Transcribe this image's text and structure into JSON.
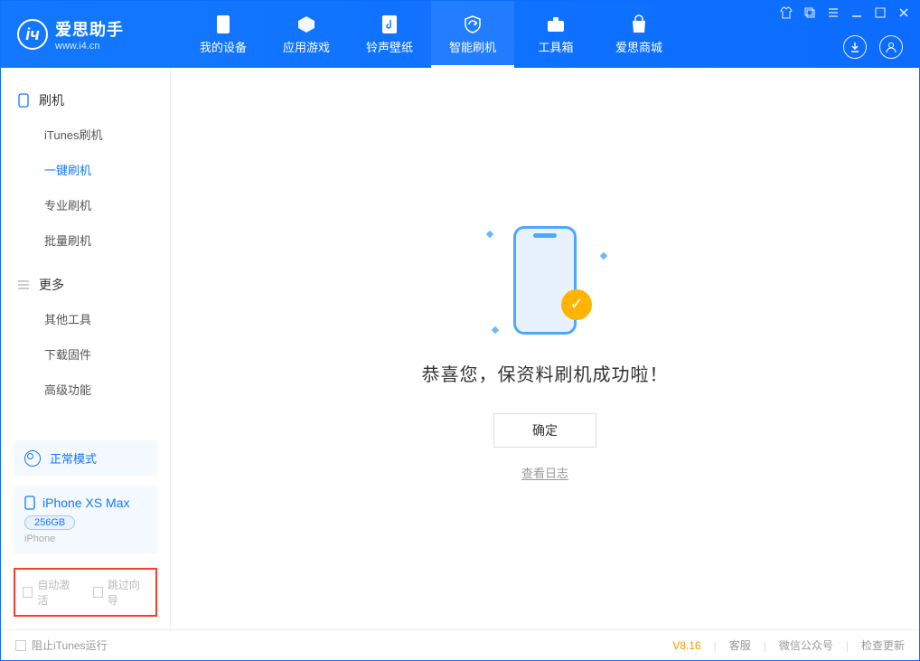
{
  "app": {
    "name": "爱思助手",
    "url": "www.i4.cn"
  },
  "nav": {
    "items": [
      {
        "label": "我的设备"
      },
      {
        "label": "应用游戏"
      },
      {
        "label": "铃声壁纸"
      },
      {
        "label": "智能刷机"
      },
      {
        "label": "工具箱"
      },
      {
        "label": "爱思商城"
      }
    ]
  },
  "sidebar": {
    "section1": {
      "title": "刷机",
      "items": [
        {
          "label": "iTunes刷机"
        },
        {
          "label": "一键刷机"
        },
        {
          "label": "专业刷机"
        },
        {
          "label": "批量刷机"
        }
      ]
    },
    "section2": {
      "title": "更多",
      "items": [
        {
          "label": "其他工具"
        },
        {
          "label": "下载固件"
        },
        {
          "label": "高级功能"
        }
      ]
    },
    "mode": "正常模式",
    "device": {
      "name": "iPhone XS Max",
      "storage": "256GB",
      "type": "iPhone"
    },
    "checks": {
      "auto_activate": "自动激活",
      "skip_guide": "跳过向导"
    }
  },
  "main": {
    "success_text": "恭喜您，保资料刷机成功啦！",
    "ok_button": "确定",
    "view_log": "查看日志"
  },
  "footer": {
    "block_itunes": "阻止iTunes运行",
    "version": "V8.16",
    "support": "客服",
    "wechat": "微信公众号",
    "update": "检查更新"
  }
}
